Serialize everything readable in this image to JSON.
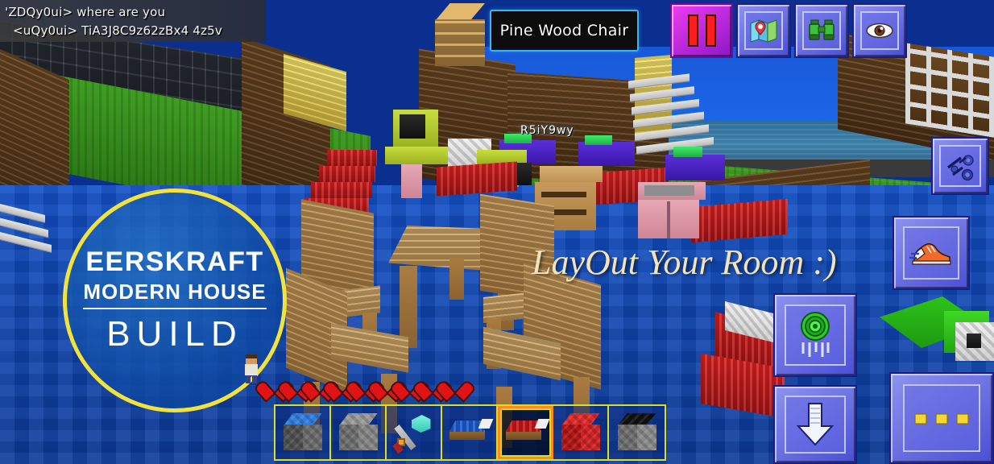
{
  "app": {
    "title": "Minecraft Pocket Edition - Gameplay",
    "background_color": "#0a2f8f"
  },
  "chat": {
    "lines": [
      "'ZDQy0ui> where are you",
      "<uQy0ui> TiA3J8C9z62zBx4 4z5v"
    ]
  },
  "item_banner": {
    "name": "Pine Wood Chair",
    "border_color": "#39b6f5",
    "background_color": "#0d0d0d"
  },
  "nametag": {
    "player": "R5iY9wy"
  },
  "watermark": {
    "title": "EERSKRAFT",
    "subtitle": "MODERN HOUSE",
    "build": "BUILD",
    "ring_color": "#f2e33c"
  },
  "overlay": {
    "text": "LayOut Your Room :)",
    "color": "#f3e3bb"
  },
  "top_buttons": [
    {
      "name": "pause-button",
      "icon": "pause-icon",
      "label": "Pause",
      "color": "#f03cf0"
    },
    {
      "name": "map-button",
      "icon": "map-icon",
      "label": "Map",
      "glyph": "🗺"
    },
    {
      "name": "binoculars-button",
      "icon": "binoculars-icon",
      "label": "Binoculars",
      "glyph": "🔭"
    },
    {
      "name": "eye-button",
      "icon": "eye-icon",
      "label": "Perspective",
      "glyph": "👁"
    }
  ],
  "side_buttons": [
    {
      "name": "meteor-button",
      "icon": "meteor-icon",
      "label": "Meteors",
      "glyph": "☄"
    },
    {
      "name": "sprint-button",
      "icon": "shoe-icon",
      "label": "Sprint",
      "glyph": "👟"
    },
    {
      "name": "portal-button",
      "icon": "portal-icon",
      "label": "Portal",
      "glyph": "◉"
    },
    {
      "name": "descend-button",
      "icon": "down-arrow-icon",
      "label": "Descend",
      "glyph": "⬇"
    },
    {
      "name": "more-options-button",
      "icon": "three-dots-icon",
      "label": "More",
      "glyph": "•••"
    }
  ],
  "health": {
    "hearts": 9,
    "heart_color": "#e01414"
  },
  "hotbar": {
    "selected_index": 4,
    "slots": [
      {
        "name": "blue-topped-stone-block",
        "label": "Blue Top Block",
        "top": "#2f7fe0",
        "left": "#4f4f4f",
        "right": "#6b6b6b",
        "type": "cube"
      },
      {
        "name": "cobblestone-block",
        "label": "Cobblestone",
        "top": "#9a9a9a",
        "left": "#6e6e6e",
        "right": "#868686",
        "type": "cube"
      },
      {
        "name": "diamond-axe",
        "label": "Diamond Axe",
        "type": "axe"
      },
      {
        "name": "blue-bed",
        "label": "Blue Bed",
        "top": "#1f5fd8",
        "type": "bed"
      },
      {
        "name": "red-bed",
        "label": "Red Bed",
        "top": "#d01919",
        "type": "bed"
      },
      {
        "name": "red-block",
        "label": "Red Block",
        "top": "#e02a2a",
        "left": "#b31414",
        "right": "#d02222",
        "type": "cube"
      },
      {
        "name": "black-topped-stone-block",
        "label": "Black Top Block",
        "top": "#101010",
        "left": "#6e6e6e",
        "right": "#8a8a8a",
        "type": "cube"
      }
    ]
  },
  "scene": {
    "floor_color": "#0f46b3",
    "sky_color": "#1b66e6",
    "grass_color": "#3b9a1e",
    "wood_color": "#a97c42"
  }
}
